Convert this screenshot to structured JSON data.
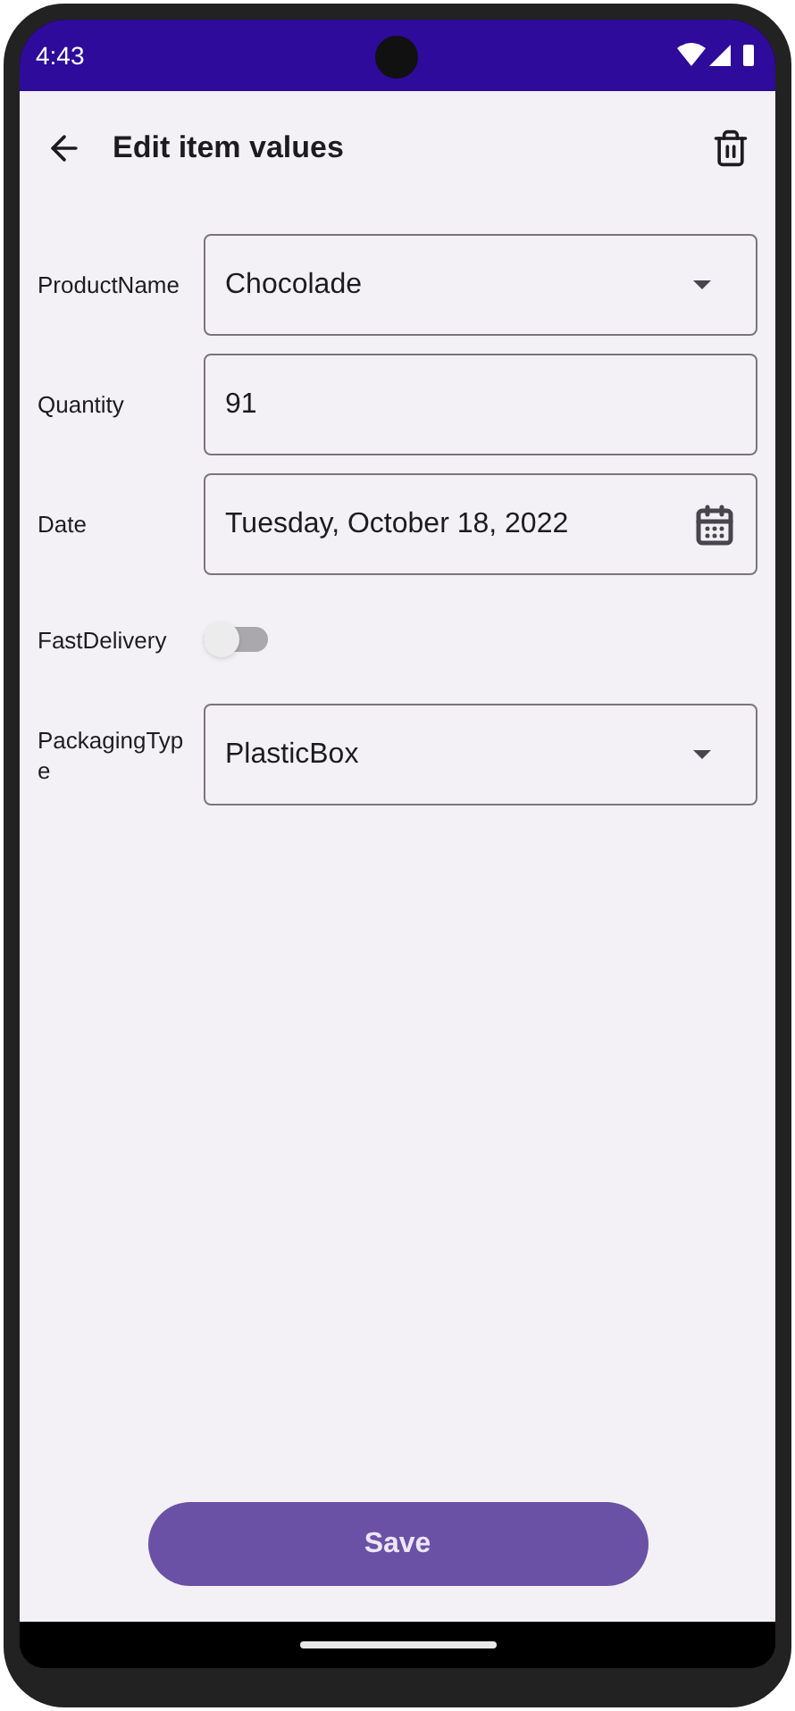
{
  "status_bar": {
    "time": "4:43"
  },
  "app_bar": {
    "title": "Edit item values"
  },
  "fields": [
    {
      "kind": "dropdown",
      "label": "ProductName",
      "value": "Chocolade"
    },
    {
      "kind": "text",
      "label": "Quantity",
      "value": "91"
    },
    {
      "kind": "date",
      "label": "Date",
      "value": "Tuesday, October 18, 2022"
    },
    {
      "kind": "switch",
      "label": "FastDelivery",
      "on": false
    },
    {
      "kind": "dropdown",
      "label": "PackagingType",
      "value": "PlasticBox"
    }
  ],
  "save_button": {
    "label": "Save"
  }
}
